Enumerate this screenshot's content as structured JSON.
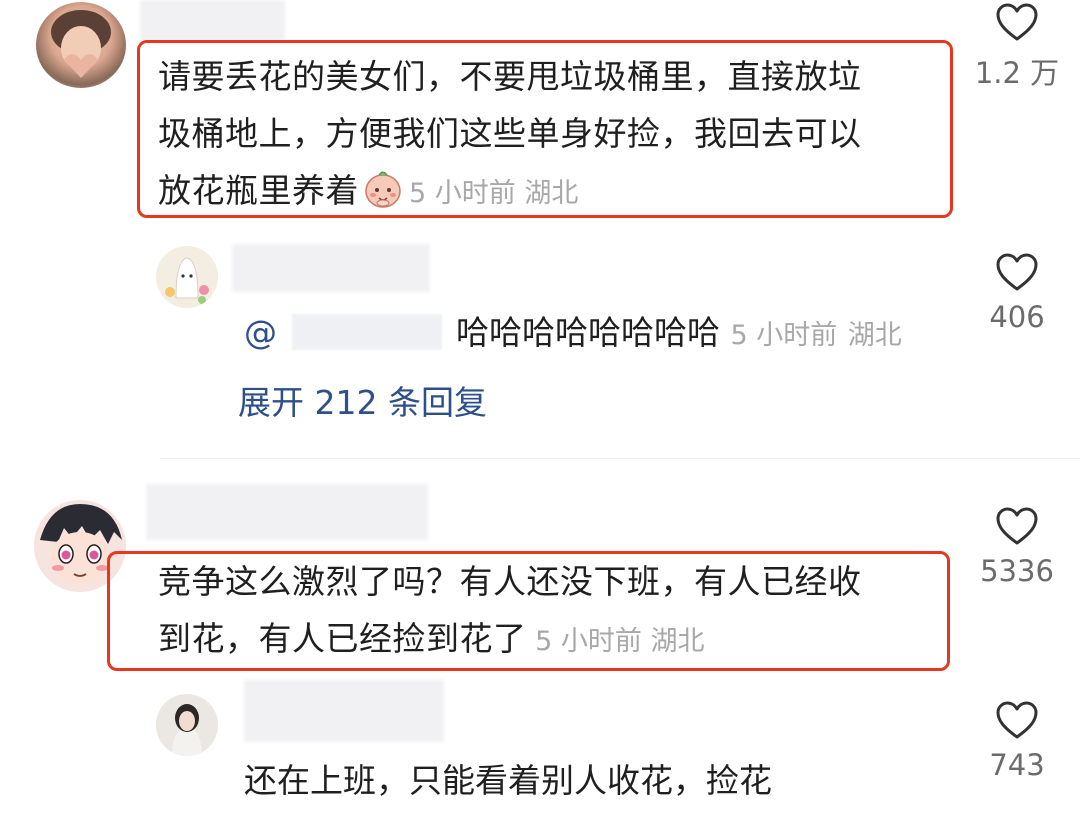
{
  "comments": [
    {
      "text": "请要丢花的美女们，不要甩垃圾桶里，直接放垃圾桶地上，方便我们这些单身好捡，我回去可以放花瓶里养着",
      "line1": "请要丢花的美女们，不要甩垃圾桶里，直接放垃",
      "line2": "圾桶地上，方便我们这些单身好捡，我回去可以",
      "line3": "放花瓶里养着",
      "emoji": "shy-peach-emoji",
      "time": "5 小时前",
      "location": "湖北",
      "likes": "1.2 万",
      "reply": {
        "at_prefix": "@",
        "text": "哈哈哈哈哈哈哈哈",
        "time": "5 小时前",
        "location": "湖北",
        "likes": "406"
      },
      "expand_label": "展开 212 条回复"
    },
    {
      "line1": "竞争这么激烈了吗？有人还没下班，有人已经收",
      "line2": "到花，有人已经捡到花了",
      "time": "5 小时前",
      "location": "湖北",
      "likes": "5336",
      "reply": {
        "text": "还在上班，只能看着别人收花，捡花",
        "likes": "743"
      }
    }
  ],
  "colors": {
    "highlight": "#e8371f",
    "link": "#2d4f8a",
    "meta": "#a8a8a8"
  },
  "icons": [
    "heart-outline-icon"
  ]
}
